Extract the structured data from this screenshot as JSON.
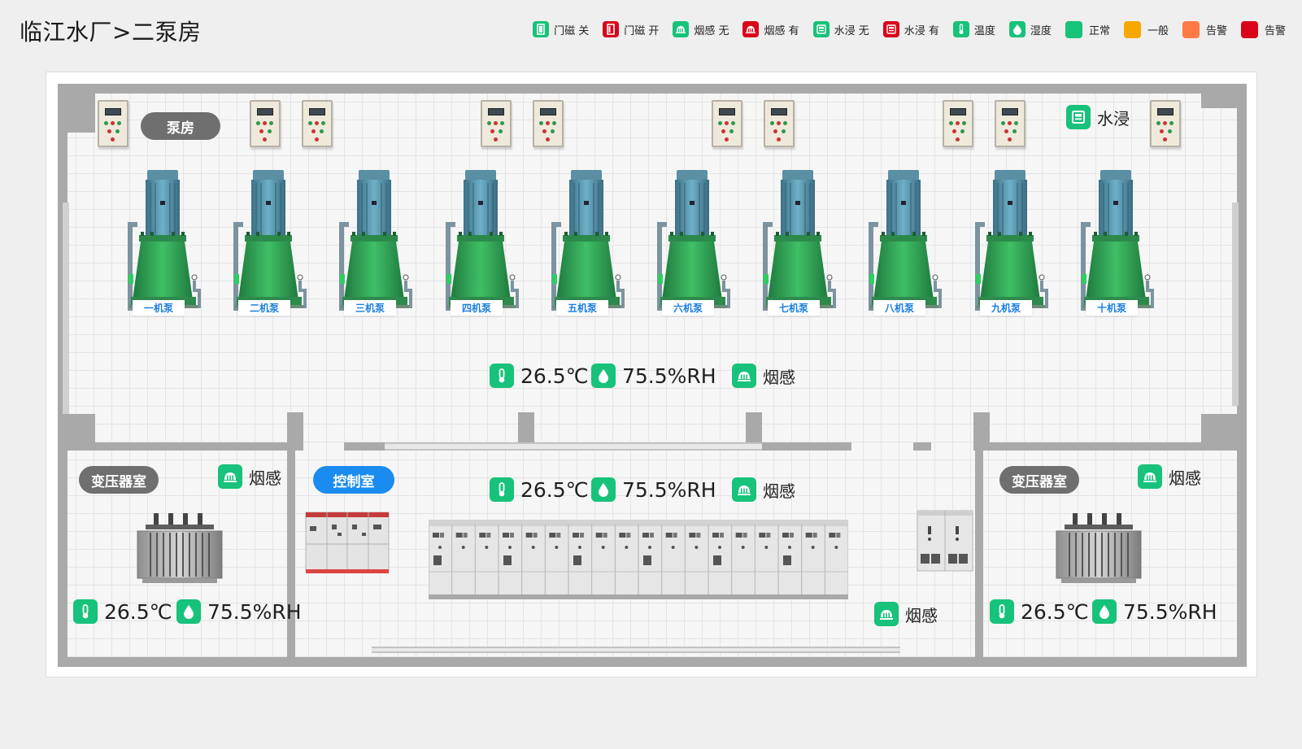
{
  "page": {
    "title": "临江水厂>二泵房"
  },
  "legend": {
    "door_closed": "门磁 关",
    "door_open": "门磁 开",
    "smoke_none": "烟感 无",
    "smoke_yes": "烟感 有",
    "water_none": "水浸 无",
    "water_yes": "水浸 有",
    "temperature": "温度",
    "humidity": "湿度",
    "normal": "正常",
    "general": "一般",
    "warning": "告警",
    "alarm": "告警"
  },
  "colors": {
    "normal": "#17c27a",
    "general": "#f7a800",
    "warning": "#ff7a45",
    "alarm": "#d9041a",
    "sensor_icon": "#17c27a",
    "room_pill_grey": "#6f6f6f",
    "room_pill_blue": "#1a8cf0",
    "pump_body": "#2f9a55",
    "pump_motor": "#4f8ea8"
  },
  "rooms": {
    "pump_room": "泵房",
    "transformer_left": "变压器室",
    "control_room": "控制室",
    "transformer_right": "变压器室"
  },
  "pumps": [
    "一机泵",
    "二机泵",
    "三机泵",
    "四机泵",
    "五机泵",
    "六机泵",
    "七机泵",
    "八机泵",
    "九机泵",
    "十机泵"
  ],
  "sensors": {
    "water_immersion": "水浸",
    "pump_room": {
      "temp": "26.5℃",
      "humidity": "75.5%RH",
      "smoke": "烟感"
    },
    "control_room": {
      "temp": "26.5℃",
      "humidity": "75.5%RH",
      "smoke": "烟感",
      "smoke_lower": "烟感"
    },
    "transformer_left": {
      "temp": "26.5℃",
      "humidity": "75.5%RH",
      "smoke": "烟感"
    },
    "transformer_right": {
      "temp": "26.5℃",
      "humidity": "75.5%RH",
      "smoke": "烟感"
    }
  }
}
